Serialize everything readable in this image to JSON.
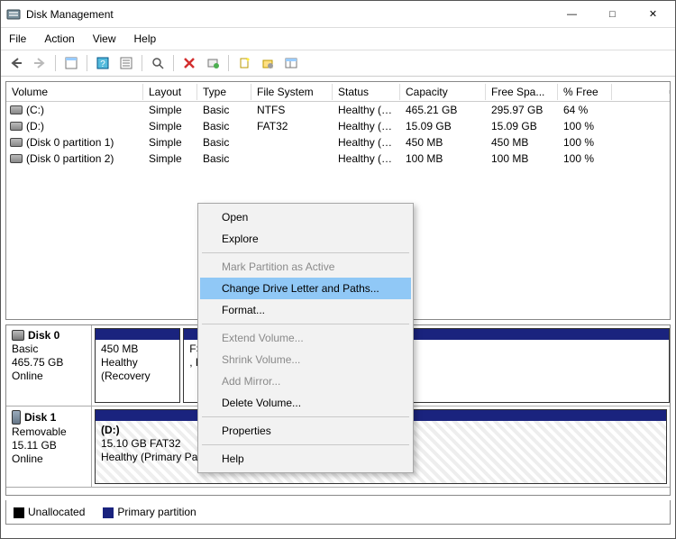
{
  "window": {
    "title": "Disk Management"
  },
  "menubar": {
    "file": "File",
    "action": "Action",
    "view": "View",
    "help": "Help"
  },
  "columns": {
    "volume": "Volume",
    "layout": "Layout",
    "type": "Type",
    "fs": "File System",
    "status": "Status",
    "capacity": "Capacity",
    "free": "Free Spa...",
    "pct": "% Free"
  },
  "volumes": [
    {
      "name": "(C:)",
      "layout": "Simple",
      "type": "Basic",
      "fs": "NTFS",
      "status": "Healthy (B...",
      "capacity": "465.21 GB",
      "free": "295.97 GB",
      "pct": "64 %"
    },
    {
      "name": "(D:)",
      "layout": "Simple",
      "type": "Basic",
      "fs": "FAT32",
      "status": "Healthy (P...",
      "capacity": "15.09 GB",
      "free": "15.09 GB",
      "pct": "100 %"
    },
    {
      "name": "(Disk 0 partition 1)",
      "layout": "Simple",
      "type": "Basic",
      "fs": "",
      "status": "Healthy (R...",
      "capacity": "450 MB",
      "free": "450 MB",
      "pct": "100 %"
    },
    {
      "name": "(Disk 0 partition 2)",
      "layout": "Simple",
      "type": "Basic",
      "fs": "",
      "status": "Healthy (E...",
      "capacity": "100 MB",
      "free": "100 MB",
      "pct": "100 %"
    }
  ],
  "disks": [
    {
      "name": "Disk 0",
      "type": "Basic",
      "size": "465.75 GB",
      "state": "Online",
      "partitions": [
        {
          "title": "",
          "line1": "450 MB",
          "line2": "Healthy (Recovery",
          "widthPct": 15
        },
        {
          "title": "",
          "line1": "FS",
          "line2": ", Page File, Crash Dump, Primary Partition)",
          "widthPct": 85
        }
      ]
    },
    {
      "name": "Disk 1",
      "type": "Removable",
      "size": "15.11 GB",
      "state": "Online",
      "partitions": [
        {
          "title": "(D:)",
          "line1": "15.10 GB FAT32",
          "line2": "Healthy (Primary Partition)",
          "widthPct": 100,
          "striped": true
        }
      ]
    }
  ],
  "legend": {
    "unallocated": "Unallocated",
    "primary": "Primary partition"
  },
  "context_menu": {
    "open": "Open",
    "explore": "Explore",
    "mark_active": "Mark Partition as Active",
    "change_letter": "Change Drive Letter and Paths...",
    "format": "Format...",
    "extend": "Extend Volume...",
    "shrink": "Shrink Volume...",
    "add_mirror": "Add Mirror...",
    "delete": "Delete Volume...",
    "properties": "Properties",
    "help": "Help"
  }
}
